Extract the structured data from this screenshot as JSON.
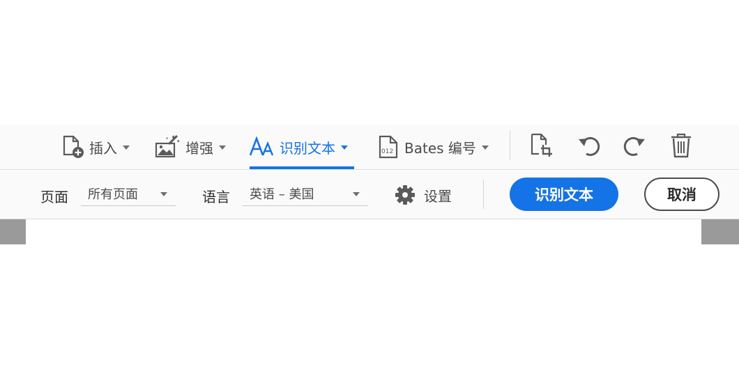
{
  "toolbar": {
    "insert_label": "插入",
    "enhance_label": "增强",
    "ocr_label": "识别文本",
    "bates_label": "Bates 编号",
    "active_tab": "识别文本",
    "accent_color": "#1473e6"
  },
  "icons": {
    "insert": "insert-page-icon",
    "enhance": "enhance-scan-icon",
    "ocr": "text-aa-icon",
    "bates": "bates-number-icon",
    "crop": "crop-page-icon",
    "rotate_ccw": "rotate-left-icon",
    "rotate_cw": "rotate-right-icon",
    "delete": "trash-icon",
    "settings": "gear-icon"
  },
  "options": {
    "pages_label": "页面",
    "pages_value": "所有页面",
    "language_label": "语言",
    "language_value": "英语 – 美国",
    "settings_label": "设置",
    "recognize_button": "识别文本",
    "cancel_button": "取消"
  }
}
